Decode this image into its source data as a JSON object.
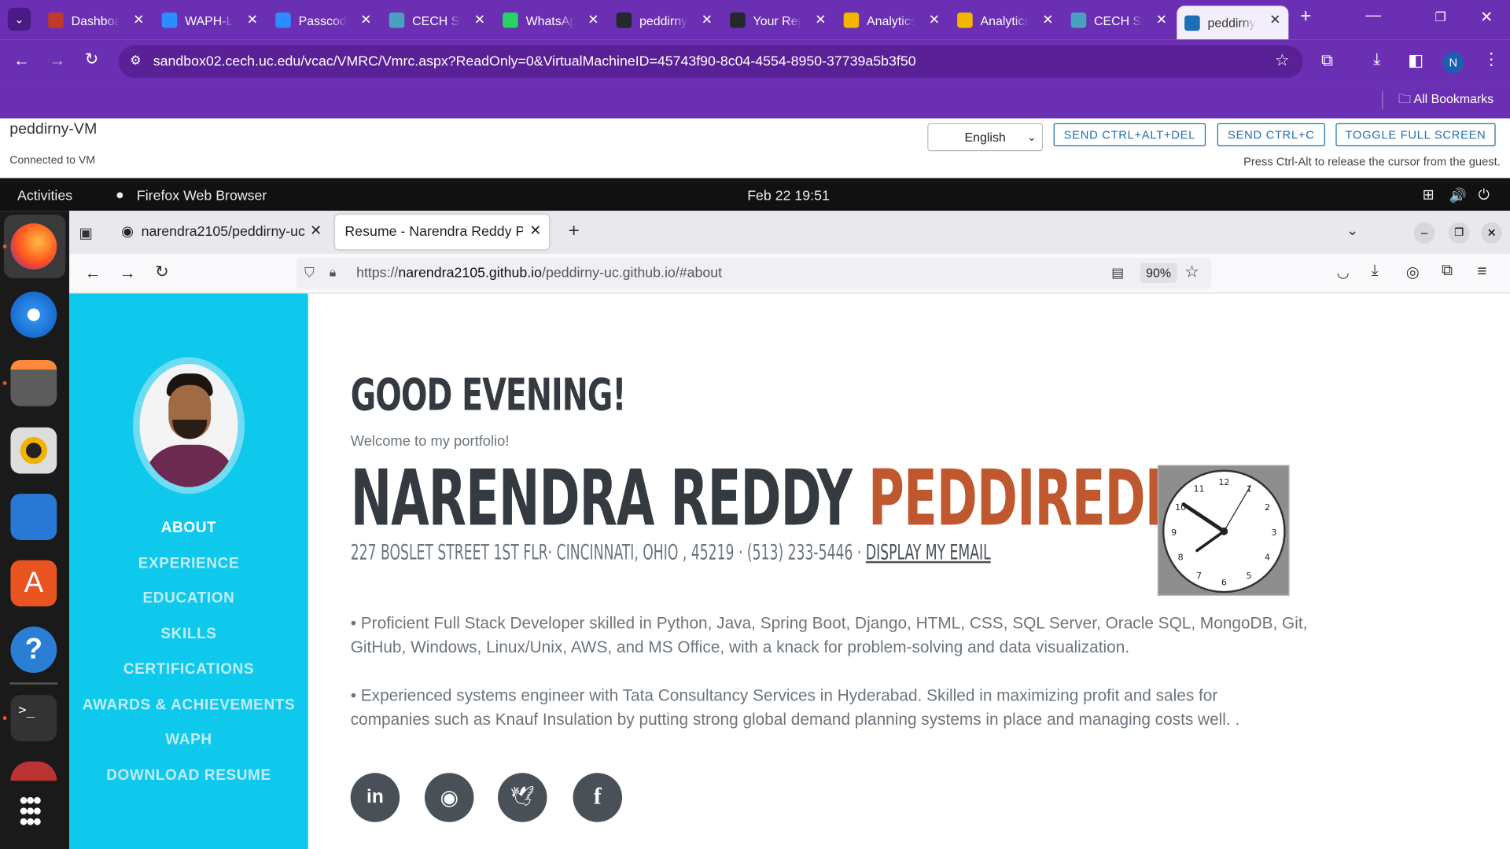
{
  "chrome": {
    "tabs": [
      {
        "label": "Dashboard",
        "fav": "#c0392b"
      },
      {
        "label": "WAPH-L",
        "fav": "#2d8cff"
      },
      {
        "label": "Passcode",
        "fav": "#2d8cff"
      },
      {
        "label": "CECH Sa",
        "fav": "#4aa0c0"
      },
      {
        "label": "WhatsApp",
        "fav": "#25d366"
      },
      {
        "label": "peddirny",
        "fav": "#24292e"
      },
      {
        "label": "Your Rep",
        "fav": "#24292e"
      },
      {
        "label": "Analytics",
        "fav": "#f4b400"
      },
      {
        "label": "Analytics",
        "fav": "#f4b400"
      },
      {
        "label": "CECH Sa",
        "fav": "#4aa0c0"
      },
      {
        "label": "peddirny",
        "fav": "#1b6fb5"
      }
    ],
    "url": "sandbox02.cech.uc.edu/vcac/VMRC/Vmrc.aspx?ReadOnly=0&VirtualMachineID=45743f90-8c04-4554-8950-37739a5b3f50",
    "bookmarks_label": "All Bookmarks",
    "profile_initial": "N"
  },
  "vm": {
    "name": "peddirny-VM",
    "status": "Connected to VM",
    "language": "English",
    "btn_ctrl_alt_del": "SEND CTRL+ALT+DEL",
    "btn_ctrl_c": "SEND CTRL+C",
    "btn_fullscreen": "TOGGLE FULL SCREEN",
    "hint": "Press Ctrl-Alt to release the cursor from the guest."
  },
  "gnome": {
    "activities": "Activities",
    "app": "Firefox Web Browser",
    "datetime": "Feb 22  19:51"
  },
  "firefox": {
    "tab1": "narendra2105/peddirny-uc",
    "tab2": "Resume - Narendra Reddy Peddireddy",
    "url_prefix": "https://",
    "url_domain": "narendra2105.github.io",
    "url_path": "/peddirny-uc.github.io/#about",
    "zoom": "90%"
  },
  "page": {
    "nav": [
      "ABOUT",
      "EXPERIENCE",
      "EDUCATION",
      "SKILLS",
      "CERTIFICATIONS",
      "AWARDS & ACHIEVEMENTS",
      "WAPH",
      "DOWNLOAD RESUME"
    ],
    "greeting": "GOOD EVENING!",
    "welcome": "Welcome to my portfolio!",
    "first_name": "NARENDRA REDDY",
    "last_name": "PEDDIREDDY",
    "address": "227 BOSLET STREET 1ST FLR· CINCINNATI, OHIO , 45219 · (513) 233-5446 · ",
    "email_link": "DISPLAY MY EMAIL",
    "bullet1": "• Proficient Full Stack Developer skilled in Python, Java, Spring Boot, Django, HTML, CSS, SQL Server, Oracle SQL, MongoDB, Git, GitHub, Windows, Linux/Unix, AWS, and MS Office, with a knack for problem-solving and data visualization.",
    "bullet2": "• Experienced systems engineer with Tata Consultancy Services in Hyderabad. Skilled in maximizing profit and sales for companies such as Knauf Insulation by putting strong global demand planning systems in place and managing costs well. .",
    "clock_numbers": [
      "12",
      "1",
      "2",
      "3",
      "4",
      "5",
      "6",
      "7",
      "8",
      "9",
      "10",
      "11"
    ],
    "colors": {
      "sidebar": "#0fc9ec",
      "accent": "#c0582f",
      "dark": "#343a40"
    }
  }
}
